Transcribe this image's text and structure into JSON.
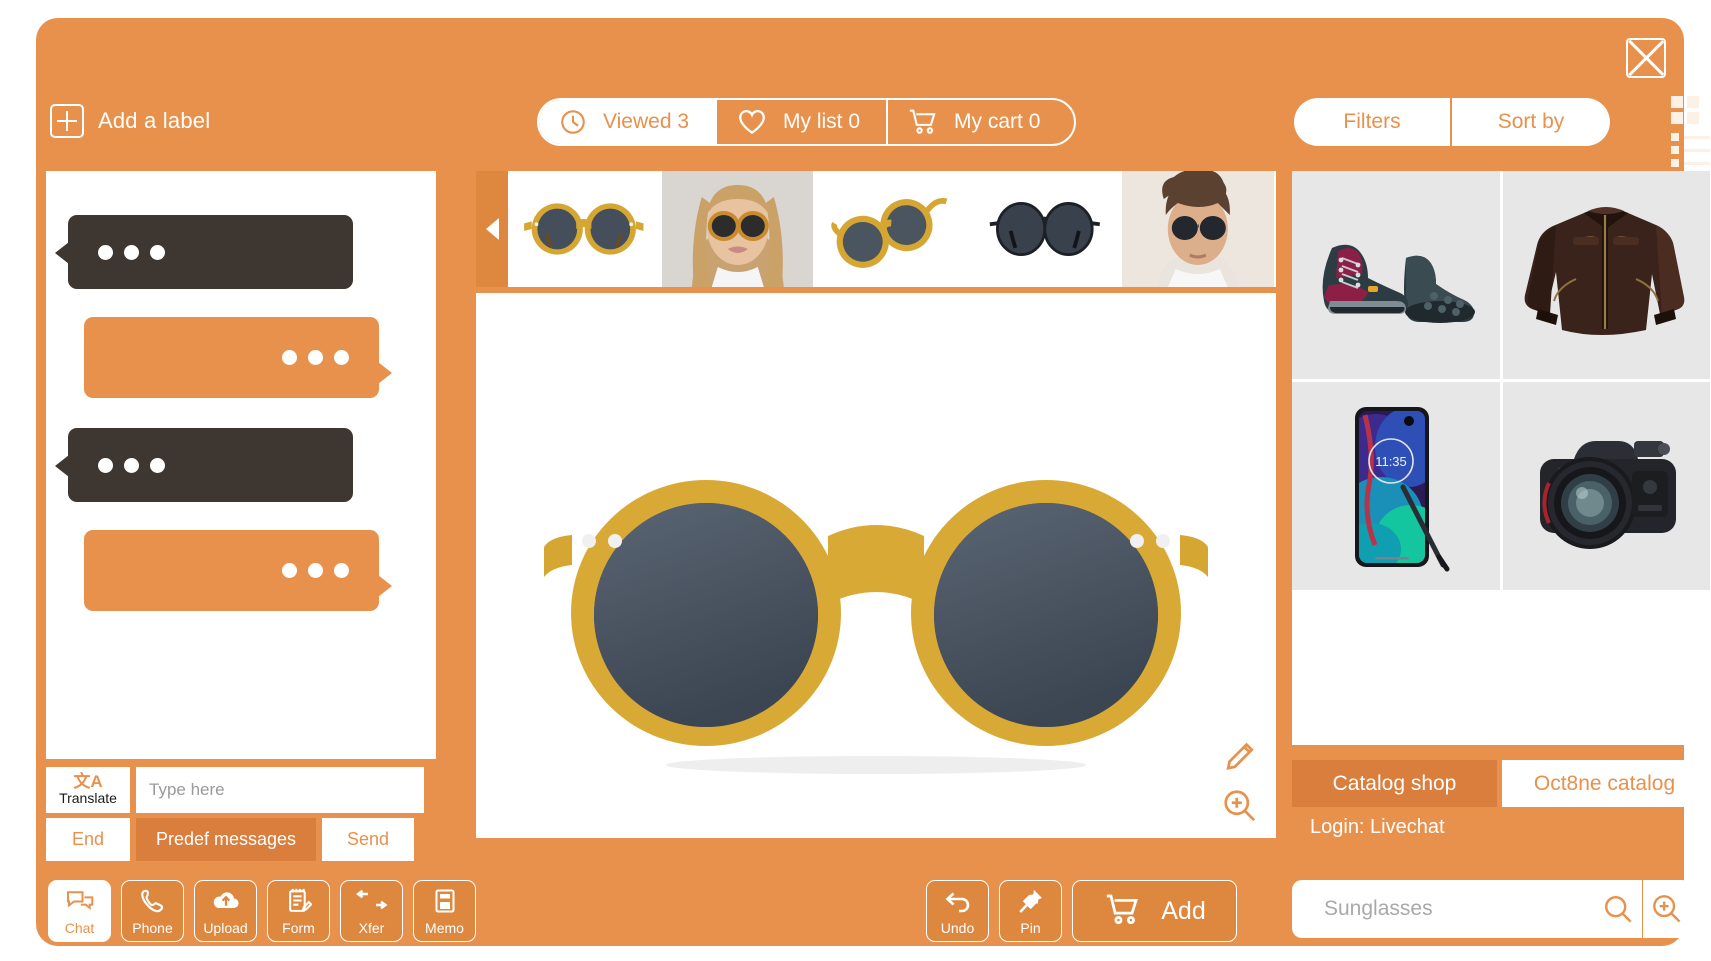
{
  "window": {
    "close_icon": "close-icon"
  },
  "topbar": {
    "add_label": "Add a label",
    "add_label_icon": "plus-square-icon",
    "nav": [
      {
        "label": "Viewed 3",
        "icon": "clock-icon",
        "active": true
      },
      {
        "label": "My list 0",
        "icon": "heart-icon",
        "active": false
      },
      {
        "label": "My cart 0",
        "icon": "cart-icon",
        "active": false
      }
    ],
    "filters_label": "Filters",
    "sort_label": "Sort by",
    "grid_view_icon": "grid-view-icon",
    "list_view_icon": "list-view-icon"
  },
  "chat": {
    "bubbles": [
      {
        "side": "agent",
        "state": "typing"
      },
      {
        "side": "user",
        "state": "typing"
      },
      {
        "side": "agent",
        "state": "typing"
      },
      {
        "side": "user",
        "state": "typing"
      }
    ],
    "translate_label": "Translate",
    "translate_glyph": "文A",
    "translate_icon": "translate-icon",
    "input_placeholder": "Type here",
    "input_value": "",
    "end_label": "End",
    "predef_label": "Predef messages",
    "send_label": "Send"
  },
  "tools": [
    {
      "label": "Chat",
      "icon": "chat-bubbles-icon",
      "active": true
    },
    {
      "label": "Phone",
      "icon": "phone-icon",
      "active": false
    },
    {
      "label": "Upload",
      "icon": "cloud-upload-icon",
      "active": false
    },
    {
      "label": "Form",
      "icon": "form-edit-icon",
      "active": false
    },
    {
      "label": "Xfer",
      "icon": "transfer-arrows-icon",
      "active": false
    },
    {
      "label": "Memo",
      "icon": "floppy-memo-icon",
      "active": false
    }
  ],
  "viewer": {
    "prev_icon": "arrow-left-icon",
    "thumbnails": [
      {
        "name": "yellow-round-sunglasses-front"
      },
      {
        "name": "woman-wearing-sunglasses"
      },
      {
        "name": "yellow-sunglasses-angled"
      },
      {
        "name": "black-round-sunglasses"
      },
      {
        "name": "man-wearing-sunglasses"
      }
    ],
    "main_product": "yellow-round-sunglasses-front",
    "edit_icon": "pencil-icon",
    "zoom_icon": "magnify-plus-icon"
  },
  "catalog": {
    "products": [
      {
        "name": "hiking-boots"
      },
      {
        "name": "leather-jacket"
      },
      {
        "name": "smartphone-stylus"
      },
      {
        "name": "dslr-camera"
      }
    ],
    "tab_shop": "Catalog shop",
    "tab_oct8ne": "Oct8ne catalog",
    "login_text": "Login: Livechat",
    "search_placeholder": "Sunglasses",
    "search_value": "",
    "search_icon": "search-icon",
    "zoom_search_icon": "magnify-plus-icon"
  },
  "center_actions": {
    "undo_label": "Undo",
    "undo_icon": "undo-arrow-icon",
    "pin_label": "Pin",
    "pin_icon": "pushpin-icon",
    "add_label": "Add",
    "add_icon": "cart-icon"
  },
  "colors": {
    "brand_orange": "#e8914c",
    "orange_dark": "#d97e3c",
    "tool_orange": "#dd873f",
    "bubble_dark": "#3e3630",
    "panel_gray": "#e7e7e7",
    "frame_yellow": "#d6a633",
    "lens_dark": "#4a5560"
  }
}
